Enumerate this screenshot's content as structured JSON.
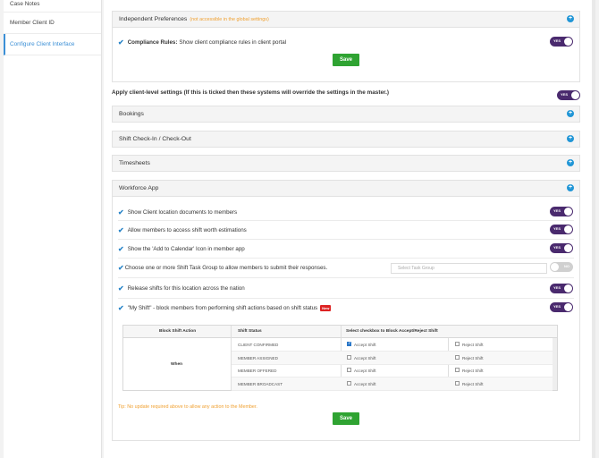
{
  "sidebar": {
    "items": [
      {
        "label": "Case Notes"
      },
      {
        "label": "Member Client ID"
      },
      {
        "label": "Configure Client Interface"
      }
    ]
  },
  "independent": {
    "title": "Independent Preferences",
    "note": "(not accessible in the global settings)",
    "compliance_bold": "Compliance Rules:",
    "compliance_text": "Show client compliance rules in client portal",
    "toggle_label": "YES",
    "save_label": "Save"
  },
  "apply_client_level": "Apply client-level settings (If this is ticked then these systems will override the settings in the master.)",
  "sections": [
    {
      "title": "Bookings"
    },
    {
      "title": "Shift Check-In / Check-Out"
    },
    {
      "title": "Timesheets"
    },
    {
      "title": "Workforce App"
    }
  ],
  "workforce": {
    "options": [
      {
        "label": "Show Client location documents to members",
        "toggle": "YES"
      },
      {
        "label": "Allow members to access shift worth estimations",
        "toggle": "YES"
      },
      {
        "label": "Show the 'Add to Calendar' Icon in member app",
        "toggle": "YES"
      },
      {
        "label": "Choose one or more Shift Task Group to allow members to submit their responses.",
        "toggle": "NO"
      },
      {
        "label": "Release shifts for this location across the nation",
        "toggle": "YES"
      },
      {
        "label": "\"My Shift\" - block members from performing shift actions based on shift status",
        "toggle": "YES"
      }
    ],
    "task_group_placeholder": "Select Task Group",
    "new_badge": "New",
    "table": {
      "headers": [
        "Block Shift Action",
        "Shift Status",
        "Select checkbox to Block Accept/Reject Shift"
      ],
      "group_label": "When",
      "accept_label": "Accept Shift",
      "reject_label": "Reject Shift",
      "rows": [
        {
          "status": "CLIENT CONFIRMED",
          "accept": true,
          "reject": false
        },
        {
          "status": "MEMBER ASSIGNED",
          "accept": false,
          "reject": false
        },
        {
          "status": "MEMBER OFFERED",
          "accept": false,
          "reject": false
        },
        {
          "status": "MEMBER BROADCAST",
          "accept": false,
          "reject": false
        }
      ]
    },
    "tip": "Tip: No update required above to allow any action to the Member.",
    "save_label": "Save"
  },
  "colors": {
    "accent": "#3b8fd6",
    "toggle_on": "#4a2a6e",
    "save": "#2fa332",
    "warning": "#f0a030",
    "badge": "#dd2222"
  }
}
